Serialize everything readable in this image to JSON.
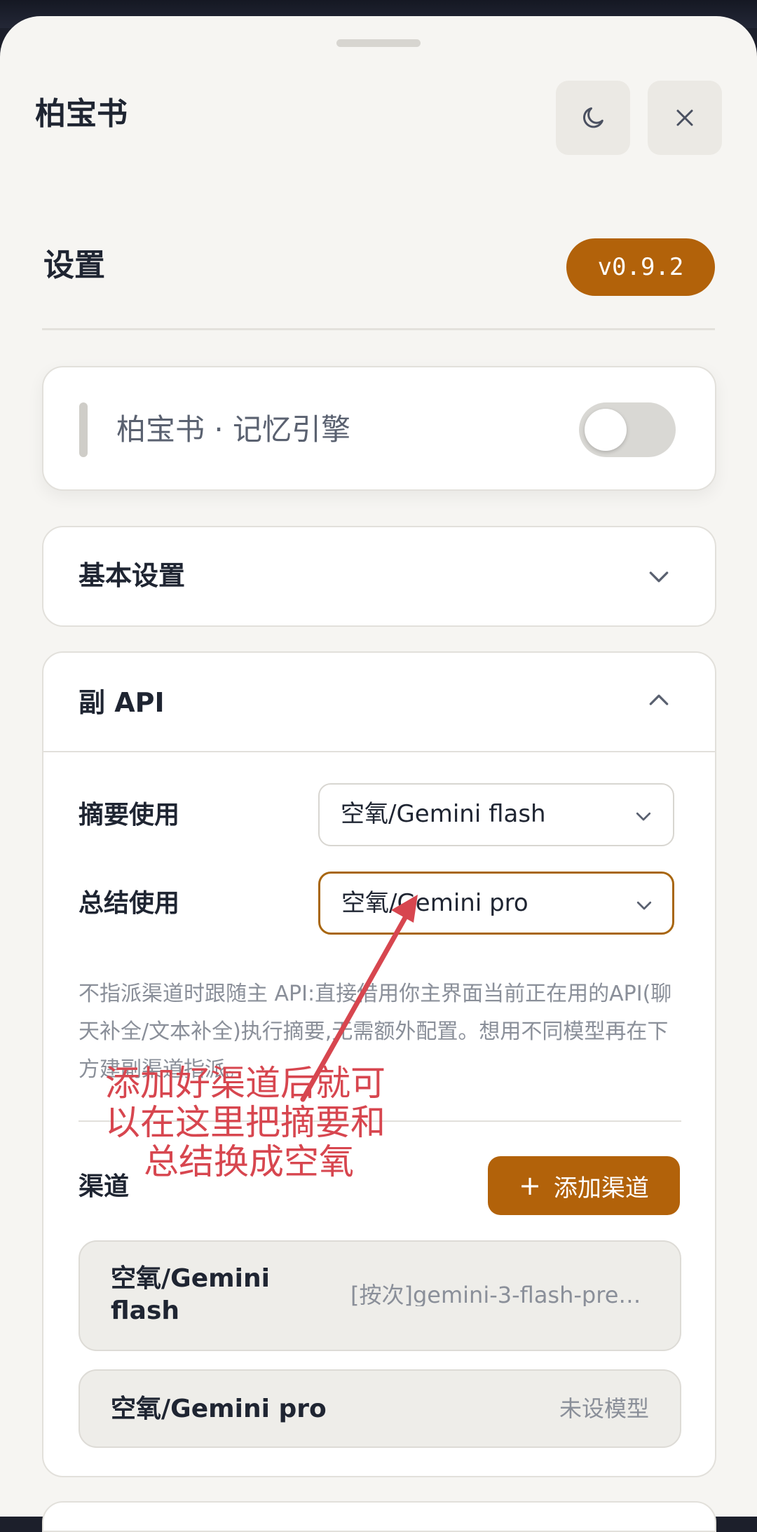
{
  "header": {
    "app_title": "柏宝书"
  },
  "settings": {
    "title": "设置",
    "version": "v0.9.2"
  },
  "engine": {
    "label": "柏宝书 · 记忆引擎",
    "enabled": false
  },
  "basic_section": {
    "title": "基本设置"
  },
  "api_section": {
    "title": "副 API",
    "summary_label": "摘要使用",
    "summary_value": "空氧/Gemini flash",
    "conclude_label": "总结使用",
    "conclude_value": "空氧/Gemini pro",
    "help_text": "不指派渠道时跟随主 API:直接借用你主界面当前正在用的API(聊天补全/文本补全)执行摘要,无需额外配置。想用不同模型再在下方建副渠道指派。",
    "channels_label": "渠道",
    "add_channel_label": "添加渠道",
    "channels": [
      {
        "name_line1": "空氧/Gemini",
        "name_line2": "flash",
        "detail": "[按次]gemini-3-flash-pre…"
      },
      {
        "name_line1": "空氧/Gemini pro",
        "name_line2": "",
        "detail": "未设模型"
      }
    ]
  },
  "annotation": {
    "line1": "添加好渠道后就可",
    "line2": "以在这里把摘要和",
    "line3": "总结换成空氧",
    "color": "#d7464f"
  },
  "colors": {
    "accent": "#b2620a",
    "background": "#f6f5f2"
  },
  "icons": {
    "theme": "moon-icon",
    "close": "close-icon"
  }
}
